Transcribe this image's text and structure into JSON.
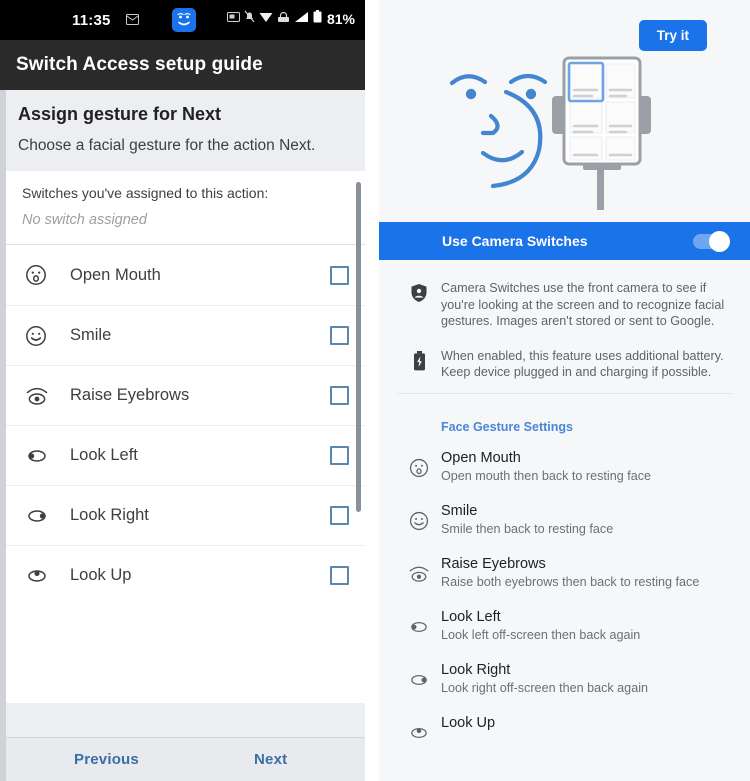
{
  "left": {
    "status_bar": {
      "time": "11:35",
      "battery_percent": "81%",
      "icons": [
        "mail-icon",
        "camera-switches-face-icon",
        "screenshot-icon",
        "notifications-off-icon",
        "wifi-icon",
        "vpn-icon",
        "signal-icon",
        "battery-icon"
      ]
    },
    "title": "Switch Access setup guide",
    "heading": "Assign gesture for Next",
    "subheading": "Choose a facial gesture for the action Next.",
    "assigned": {
      "label": "Switches you've assigned to this action:",
      "value": "No switch assigned"
    },
    "gestures": [
      {
        "name": "Open Mouth",
        "icon": "open-mouth-face-icon",
        "checked": false
      },
      {
        "name": "Smile",
        "icon": "smile-face-icon",
        "checked": false
      },
      {
        "name": "Raise Eyebrows",
        "icon": "raise-eyebrows-eye-icon",
        "checked": false
      },
      {
        "name": "Look Left",
        "icon": "look-left-eye-icon",
        "checked": false
      },
      {
        "name": "Look Right",
        "icon": "look-right-eye-icon",
        "checked": false
      },
      {
        "name": "Look Up",
        "icon": "look-up-eye-icon",
        "checked": false
      }
    ],
    "footer": {
      "previous": "Previous",
      "next": "Next"
    }
  },
  "right": {
    "try_it": "Try it",
    "illustration": "face-and-phone-on-stand-illustration",
    "toggle": {
      "label": "Use Camera Switches",
      "enabled": true
    },
    "info": [
      {
        "icon": "privacy-shield-icon",
        "text": "Camera Switches use the front camera to see if you're looking at the screen and to recognize facial gestures. Images aren't stored or sent to Google."
      },
      {
        "icon": "battery-charging-icon",
        "text": "When enabled, this feature uses additional battery. Keep device plugged in and charging if possible."
      }
    ],
    "section_title": "Face Gesture Settings",
    "settings": [
      {
        "icon": "open-mouth-face-icon",
        "title": "Open Mouth",
        "subtitle": "Open mouth then back to resting face"
      },
      {
        "icon": "smile-face-icon",
        "title": "Smile",
        "subtitle": "Smile then back to resting face"
      },
      {
        "icon": "raise-eyebrows-eye-icon",
        "title": "Raise Eyebrows",
        "subtitle": "Raise both eyebrows then back to resting face"
      },
      {
        "icon": "look-left-eye-icon",
        "title": "Look Left",
        "subtitle": "Look left off-screen then back again"
      },
      {
        "icon": "look-right-eye-icon",
        "title": "Look Right",
        "subtitle": "Look right off-screen then back again"
      },
      {
        "icon": "look-up-eye-icon",
        "title": "Look Up",
        "subtitle": ""
      }
    ]
  },
  "colors": {
    "accent_blue": "#1a73e8",
    "status_bar_black": "#000000",
    "title_bar_gray": "#2a2a2a",
    "panel_bg": "#f6f7f8",
    "link_blue": "#4a86d8",
    "checkbox_blue": "#5b87ae"
  }
}
